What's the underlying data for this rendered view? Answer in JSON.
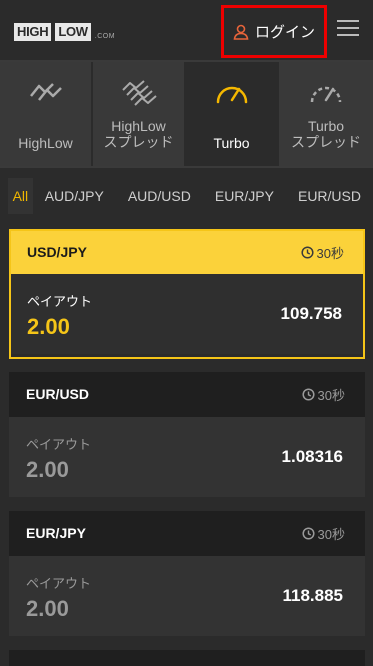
{
  "header": {
    "logo": {
      "high": "HIGH",
      "low": "LOW",
      "com": ".COM"
    },
    "login_label": "ログイン"
  },
  "modes": [
    {
      "label": "HighLow",
      "icon": "highlow-icon"
    },
    {
      "label": "HighLow\nスプレッド",
      "icon": "highlow-spread-icon"
    },
    {
      "label": "Turbo",
      "icon": "turbo-gauge-icon"
    },
    {
      "label": "Turbo\nスプレッド",
      "icon": "turbo-spread-gauge-icon"
    }
  ],
  "currency_tabs": [
    "All",
    "AUD/JPY",
    "AUD/USD",
    "EUR/JPY",
    "EUR/USD"
  ],
  "cards": [
    {
      "pair": "USD/JPY",
      "timer": "30秒",
      "payout_label": "ペイアウト",
      "payout": "2.00",
      "rate": "109.758"
    },
    {
      "pair": "EUR/USD",
      "timer": "30秒",
      "payout_label": "ペイアウト",
      "payout": "2.00",
      "rate": "1.08316"
    },
    {
      "pair": "EUR/JPY",
      "timer": "30秒",
      "payout_label": "ペイアウト",
      "payout": "2.00",
      "rate": "118.885"
    }
  ],
  "colors": {
    "accent": "#f5c518",
    "login_border": "#ee0000",
    "background": "#2b2b2b"
  }
}
